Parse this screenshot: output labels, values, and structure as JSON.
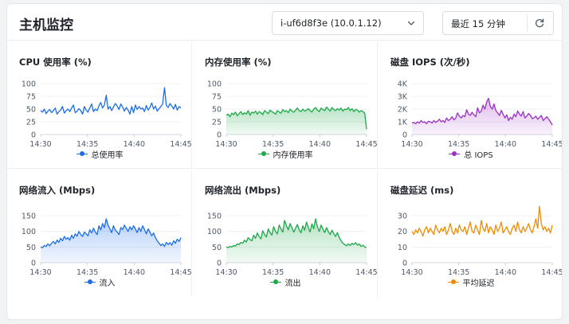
{
  "header": {
    "title": "主机监控",
    "instance": "i-uf6d8f3e (10.0.1.12)",
    "time_range": "最近 15 分钟"
  },
  "icons": {
    "instance_select": "chevron-down-icon",
    "refresh": "refresh-icon"
  },
  "chart_data": [
    {
      "type": "line",
      "title": "CPU 使用率 (%)",
      "x": [
        "14:30",
        "14:35",
        "14:40",
        "14:45"
      ],
      "ylim": [
        0,
        100
      ],
      "yticks": [
        0,
        25,
        50,
        75,
        100
      ],
      "grid": true,
      "legend_position": "bottom-center",
      "area": false,
      "color": "#1b6ee8",
      "series": [
        {
          "name": "总使用率",
          "values": [
            47,
            44,
            50,
            41,
            46,
            49,
            43,
            47,
            52,
            40,
            45,
            48,
            55,
            42,
            47,
            50,
            45,
            52,
            58,
            43,
            46,
            51,
            47,
            40,
            55,
            48,
            44,
            52,
            60,
            45,
            50,
            47,
            56,
            63,
            52,
            58,
            77,
            50,
            55,
            47,
            54,
            61,
            56,
            49,
            60,
            54,
            46,
            53,
            48,
            40,
            55,
            43,
            58,
            49,
            55,
            50,
            52,
            45,
            57,
            48,
            53,
            62,
            50,
            56,
            46,
            51,
            55,
            60,
            92,
            57,
            53,
            61,
            56,
            50,
            59,
            48,
            55,
            52
          ]
        }
      ]
    },
    {
      "type": "area",
      "title": "内存使用率 (%)",
      "x": [
        "14:30",
        "14:35",
        "14:40",
        "14:45"
      ],
      "ylim": [
        0,
        100
      ],
      "yticks": [
        0,
        25,
        50,
        75,
        100
      ],
      "grid": true,
      "legend_position": "bottom-center",
      "area": true,
      "color": "#1ea84a",
      "series": [
        {
          "name": "内存使用率",
          "values": [
            38,
            40,
            35,
            42,
            39,
            44,
            37,
            41,
            45,
            39,
            43,
            40,
            47,
            38,
            44,
            42,
            46,
            40,
            45,
            43,
            39,
            47,
            44,
            41,
            48,
            45,
            43,
            40,
            47,
            44,
            42,
            49,
            45,
            47,
            43,
            50,
            46,
            44,
            48,
            52,
            47,
            45,
            50,
            46,
            48,
            51,
            47,
            44,
            50,
            53,
            48,
            45,
            52,
            49,
            47,
            54,
            50,
            46,
            53,
            49,
            47,
            51,
            48,
            52,
            46,
            50,
            49,
            53,
            47,
            51,
            45,
            49,
            48,
            44,
            47,
            45,
            42,
            10
          ]
        }
      ]
    },
    {
      "type": "area",
      "title": "磁盘 IOPS (次/秒)",
      "x": [
        "14:30",
        "14:35",
        "14:40",
        "14:45"
      ],
      "ylim": [
        0,
        4000
      ],
      "ytick_labels": [
        "0",
        "1K",
        "2K",
        "3K",
        "4K"
      ],
      "yticks": [
        0,
        1000,
        2000,
        3000,
        4000
      ],
      "grid": true,
      "legend_position": "bottom-center",
      "area": true,
      "color": "#9b30c4",
      "series": [
        {
          "name": "总 IOPS",
          "values": [
            900,
            950,
            850,
            1000,
            900,
            1100,
            950,
            1000,
            850,
            1050,
            1000,
            900,
            1100,
            950,
            1050,
            1200,
            1000,
            1100,
            950,
            1300,
            1100,
            1200,
            1400,
            1150,
            1300,
            1700,
            1450,
            1300,
            1500,
            1400,
            1950,
            1600,
            1500,
            1750,
            1550,
            1400,
            2100,
            1700,
            1850,
            2300,
            2000,
            2550,
            2850,
            2200,
            2000,
            2400,
            1900,
            1700,
            1500,
            1900,
            1600,
            1300,
            1550,
            1100,
            1350,
            1200,
            1600,
            1400,
            1850,
            1600,
            1450,
            1800,
            1300,
            1450,
            1650,
            1500,
            1250,
            1300,
            1450,
            1200,
            1350,
            1500,
            1100,
            1250,
            1400,
            1200,
            1000,
            750
          ]
        }
      ]
    },
    {
      "type": "area",
      "title": "网络流入 (Mbps)",
      "x": [
        "14:30",
        "14:35",
        "14:40",
        "14:45"
      ],
      "ylim": [
        0,
        150
      ],
      "yticks": [
        0,
        50,
        100,
        150
      ],
      "grid": true,
      "legend_position": "bottom-center",
      "area": true,
      "color": "#1b6ee8",
      "series": [
        {
          "name": "流入",
          "values": [
            50,
            48,
            55,
            52,
            60,
            54,
            62,
            68,
            60,
            72,
            65,
            78,
            70,
            84,
            75,
            80,
            72,
            88,
            78,
            92,
            85,
            100,
            90,
            84,
            98,
            92,
            86,
            105,
            95,
            110,
            98,
            90,
            118,
            105,
            125,
            112,
            140,
            120,
            108,
            96,
            118,
            104,
            98,
            90,
            112,
            106,
            120,
            110,
            100,
            115,
            105,
            118,
            108,
            96,
            112,
            100,
            118,
            106,
            92,
            108,
            98,
            86,
            95,
            80,
            70,
            62,
            55,
            60,
            52,
            65,
            58,
            64,
            56,
            70,
            62,
            75,
            68,
            80
          ]
        }
      ]
    },
    {
      "type": "area",
      "title": "网络流出 (Mbps)",
      "x": [
        "14:30",
        "14:35",
        "14:40",
        "14:45"
      ],
      "ylim": [
        0,
        150
      ],
      "yticks": [
        0,
        50,
        100,
        150
      ],
      "grid": true,
      "legend_position": "bottom-center",
      "area": true,
      "color": "#1ea84a",
      "series": [
        {
          "name": "流出",
          "values": [
            50,
            48,
            52,
            50,
            55,
            53,
            60,
            58,
            65,
            62,
            72,
            66,
            80,
            74,
            70,
            88,
            78,
            95,
            84,
            76,
            102,
            90,
            82,
            108,
            96,
            88,
            115,
            100,
            92,
            120,
            108,
            98,
            135,
            118,
            105,
            125,
            112,
            98,
            110,
            122,
            106,
            95,
            118,
            104,
            130,
            112,
            98,
            124,
            108,
            140,
            115,
            100,
            120,
            108,
            96,
            112,
            100,
            90,
            104,
            92,
            84,
            96,
            80,
            70,
            62,
            58,
            54,
            60,
            55,
            62,
            58,
            64,
            56,
            60,
            52,
            56,
            50,
            48
          ]
        }
      ]
    },
    {
      "type": "line",
      "title": "磁盘延迟 (ms)",
      "x": [
        "14:30",
        "14:35",
        "14:40",
        "14:45"
      ],
      "ylim": [
        0,
        30
      ],
      "yticks": [
        0,
        10,
        20,
        30
      ],
      "grid": true,
      "legend_position": "bottom-center",
      "area": false,
      "color": "#f08c00",
      "series": [
        {
          "name": "平均延迟",
          "values": [
            20,
            18,
            21,
            19,
            22,
            20,
            17,
            21,
            23,
            19,
            22,
            20,
            18,
            24,
            21,
            19,
            22,
            20,
            23,
            18,
            21,
            25,
            20,
            18,
            22,
            19,
            24,
            21,
            20,
            23,
            18,
            22,
            26,
            20,
            19,
            24,
            21,
            18,
            27,
            22,
            20,
            25,
            19,
            23,
            21,
            18,
            24,
            20,
            22,
            26,
            19,
            21,
            23,
            20,
            18,
            22,
            24,
            20,
            26,
            21,
            19,
            23,
            20,
            22,
            25,
            21,
            19,
            23,
            28,
            22,
            36,
            25,
            21,
            23,
            20,
            22,
            19,
            24
          ]
        }
      ]
    }
  ]
}
